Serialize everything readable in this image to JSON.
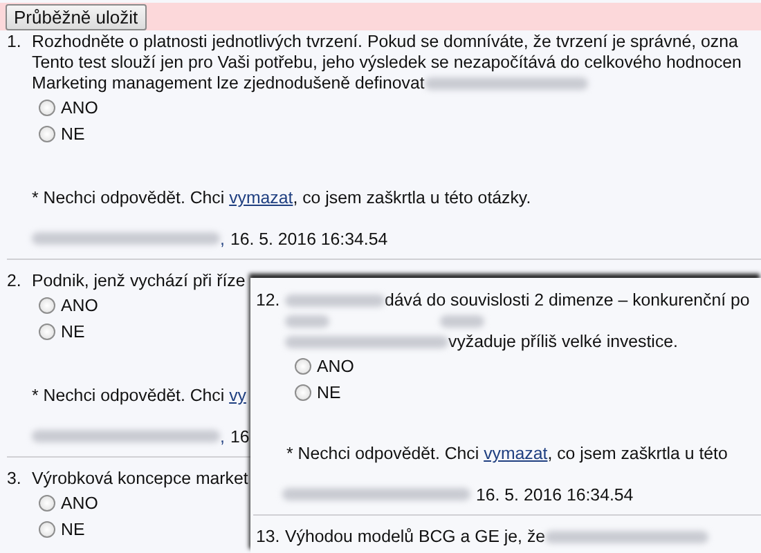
{
  "save_button": "Průběžně uložit",
  "questions": [
    {
      "number": "1.",
      "lines": [
        [
          {
            "kind": "text",
            "text": "Rozhodněte o platnosti jednotlivých tvrzení. Pokud se domníváte, že tvrzení je správné, ozna"
          }
        ],
        [
          {
            "kind": "text",
            "text": "Tento test slouží jen pro Vaši potřebu, jeho výsledek se nezapočítává do celkového hodnocen"
          }
        ],
        [
          {
            "kind": "text",
            "text": "Marketing management lze zjednodušeně definovat "
          },
          {
            "kind": "redacted_long"
          }
        ]
      ],
      "options": [
        {
          "label": "ANO",
          "selected": false
        },
        {
          "label": "NE",
          "selected": false
        }
      ],
      "note": {
        "before": "* Nechci odpovědět. Chci ",
        "link": "vymazat",
        "after": ", co jsem zaškrtla u této otázky."
      },
      "signature": {
        "separator": ",",
        "timestamp": "16. 5. 2016 16:34.54"
      }
    },
    {
      "number": "2.",
      "lines": [
        [
          {
            "kind": "text",
            "text": "Podnik, jenž vychází při říze"
          }
        ]
      ],
      "options": [
        {
          "label": "ANO",
          "selected": false
        },
        {
          "label": "NE",
          "selected": false
        }
      ],
      "note": {
        "before": "* Nechci odpovědět. Chci ",
        "link": "vy"
      },
      "signature": {
        "separator": ",",
        "timestamp": "16"
      }
    },
    {
      "number": "3.",
      "lines": [
        [
          {
            "kind": "text",
            "text": "Výrobková koncepce market"
          }
        ]
      ],
      "options": [
        {
          "label": "ANO",
          "selected": false
        },
        {
          "label": "NE",
          "selected": false
        }
      ]
    }
  ],
  "overlay": {
    "questions": [
      {
        "number": "12.",
        "lines": [
          [
            {
              "kind": "redacted_medium"
            },
            {
              "kind": "text",
              "text": "dává do souvislosti 2 dimenze – konkurenční po"
            }
          ],
          [
            {
              "kind": "redacted_short"
            },
            {
              "kind": "gap"
            },
            {
              "kind": "redacted_short"
            }
          ],
          [
            {
              "kind": "redacted_long"
            },
            {
              "kind": "text",
              "text": "vyžaduje příliš velké investice."
            }
          ]
        ],
        "options": [
          {
            "label": "ANO",
            "selected": false
          },
          {
            "label": "NE",
            "selected": false
          }
        ],
        "note": {
          "before": "* Nechci odpovědět. Chci ",
          "link": "vymazat",
          "after": ", co jsem zaškrtla u této"
        },
        "signature": {
          "timestamp": "16. 5. 2016 16:34.54"
        }
      },
      {
        "number": "13.",
        "lines": [
          [
            {
              "kind": "text",
              "text": "Výhodou modelů BCG a GE je, že "
            },
            {
              "kind": "redacted_long"
            }
          ]
        ]
      }
    ]
  }
}
